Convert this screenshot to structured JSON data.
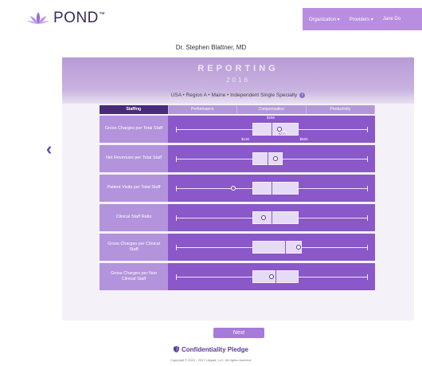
{
  "header": {
    "brand": "POND",
    "trademark": "™",
    "nav": [
      "Organization ▾",
      "Providers ▾",
      "Jane Do"
    ]
  },
  "doctor_name": "Dr. Stephen Blattner, MD",
  "hero": {
    "title": "REPORTING",
    "year": "2016"
  },
  "region_text": "USA • Region A • Maine • Independent Single Specialty",
  "tabs": [
    {
      "label": "Staffing",
      "active": true
    },
    {
      "label": "Performance",
      "active": false
    },
    {
      "label": "Compensation",
      "active": false
    },
    {
      "label": "Productivity",
      "active": false
    }
  ],
  "metrics": [
    {
      "label": "Gross Charges per Total Staff",
      "box_low": 0.4,
      "box_high": 0.64,
      "median": 0.5,
      "dot": 0.54,
      "annotations": {
        "top": "$250",
        "left": "$130",
        "right": "$500",
        "dot": "$270"
      }
    },
    {
      "label": "Net Revenues per Total Staff",
      "box_low": 0.4,
      "box_high": 0.56,
      "median": 0.48,
      "dot": 0.52
    },
    {
      "label": "Patient Visits per Total Staff",
      "box_low": 0.4,
      "box_high": 0.64,
      "median": 0.5,
      "dot": 0.3
    },
    {
      "label": "Clinical Staff Ratio",
      "box_low": 0.4,
      "box_high": 0.64,
      "median": 0.5,
      "dot": 0.46
    },
    {
      "label": "Gross Charges per Clinical Staff",
      "box_low": 0.4,
      "box_high": 0.66,
      "median": 0.57,
      "dot": 0.64
    },
    {
      "label": "Gross Charges per Non Clinical Staff",
      "box_low": 0.4,
      "box_high": 0.64,
      "median": 0.52,
      "dot": 0.5
    }
  ],
  "back_label": "‹",
  "next_label": "Next",
  "pledge_label": "Confidentiality Pledge",
  "copyright": "Copyright © 2015 - 2017 Lilypad, LLC. All rights reserved.",
  "colors": {
    "accent": "#8a58c8",
    "dark": "#4a2b7a",
    "brand": "#5b3c8e"
  }
}
